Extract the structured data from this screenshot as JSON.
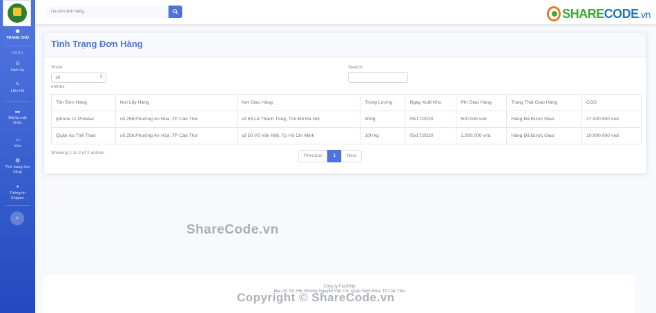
{
  "sidebar": {
    "items": [
      {
        "label": "TRANG CHỦ",
        "icon": "tachometer-icon"
      },
      {
        "label": "Dịch Vụ",
        "icon": "cog-icon"
      },
      {
        "label": "Liên Hệ",
        "icon": "wrench-icon"
      },
      {
        "label": "Đặt lại mật khẩu",
        "icon": "folder-icon"
      },
      {
        "label": "Kho",
        "icon": "truck-icon"
      },
      {
        "label": "Tình trạng đơn hàng",
        "icon": "table-icon"
      },
      {
        "label": "Thông tin Shipper",
        "icon": "user-icon"
      }
    ],
    "menu_heading": "MENU",
    "toggle": "›"
  },
  "topbar": {
    "search_placeholder": "Tra cứu đơn hàng..."
  },
  "brand": {
    "name_part1": "SHARE",
    "name_part2": "CODE",
    "name_part3": ".vn"
  },
  "card": {
    "title": "Tình Trạng Đơn Hàng",
    "show_label": "Show",
    "show_value": "10",
    "entries_label": "entries",
    "search_label": "Search:",
    "columns": [
      "Tên Đơn Hàng",
      "Nơi Lấy Hàng",
      "Nơi Giao Hàng",
      "Trọng Lượng",
      "Ngày Xuất Kho",
      "Phí Giao Hàng",
      "Trạng Thái Giao Hàng",
      "COD"
    ],
    "rows": [
      [
        "Iphone 11 ProMax",
        "số 256,Phường An Hòa ,TP Cần Thơ",
        "số 50,Lê Thánh Tông ,Thủ Đô Hà Nội",
        "400g",
        "05/17/2020",
        "500.000 vnd",
        "Hàng Đã Được Giao",
        "27.000.000 vnd"
      ],
      [
        "Quần Áo Thể Thao",
        "số 256,Phường An Hòa ,TP Cần Thơ",
        "số 50,Võ Văn Kiệt, Tp Hồ Chí Minh",
        "100 kg",
        "05/17/2020",
        "1.000.000 vnd",
        "Hàng Đã Được Giao",
        "10.000.000 vnd"
      ]
    ],
    "info": "Showing 1 to 2 of 2 entries",
    "pager": {
      "prev": "Previous",
      "current": "1",
      "next": "Next"
    }
  },
  "footer": {
    "line1": "Công ty FastShip",
    "line2": "Địa chỉ: Số 256, Đường Nguyễn Văn Cừ, Quận Ninh Kiều, TP Cần Thơ"
  },
  "watermark": {
    "center": "ShareCode.vn",
    "bottom": "Copyright © ShareCode.vn"
  },
  "colors": {
    "primary": "#4e73df",
    "sidebar_dark": "#224abe",
    "brand_green": "#3aaa35",
    "brand_blue": "#1e73be"
  }
}
